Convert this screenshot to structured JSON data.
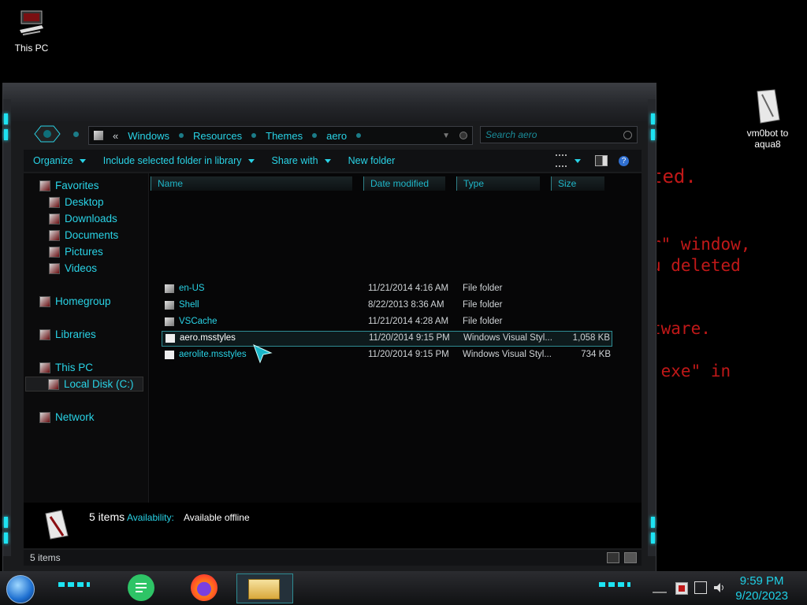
{
  "desktop": {
    "icons": [
      {
        "label": "This PC"
      },
      {
        "label": "vm0bot to aqua8"
      }
    ],
    "background_text": [
      "ted.",
      "r\" window,",
      "u deleted",
      "tware.",
      ".exe\" in"
    ]
  },
  "explorer": {
    "breadcrumb": [
      "«",
      "Windows",
      "Resources",
      "Themes",
      "aero"
    ],
    "search_placeholder": "Search aero",
    "toolbar": {
      "organize": "Organize",
      "include": "Include selected folder in library",
      "share": "Share with",
      "new_folder": "New folder"
    },
    "nav": {
      "favorites": "Favorites",
      "desktop": "Desktop",
      "downloads": "Downloads",
      "documents": "Documents",
      "pictures": "Pictures",
      "videos": "Videos",
      "homegroup": "Homegroup",
      "libraries": "Libraries",
      "this_pc": "This PC",
      "local_disk": "Local Disk (C:)",
      "network": "Network"
    },
    "columns": {
      "name": "Name",
      "date": "Date modified",
      "type": "Type",
      "size": "Size"
    },
    "files": [
      {
        "name": "en-US",
        "date": "11/21/2014 4:16 AM",
        "type": "File folder",
        "size": ""
      },
      {
        "name": "Shell",
        "date": "8/22/2013 8:36 AM",
        "type": "File folder",
        "size": ""
      },
      {
        "name": "VSCache",
        "date": "11/21/2014 4:28 AM",
        "type": "File folder",
        "size": ""
      },
      {
        "name": "aero.msstyles",
        "date": "11/20/2014 9:15 PM",
        "type": "Windows Visual Styl...",
        "size": "1,058 KB"
      },
      {
        "name": "aerolite.msstyles",
        "date": "11/20/2014 9:15 PM",
        "type": "Windows Visual Styl...",
        "size": "734 KB"
      }
    ],
    "details": {
      "count": "5 items",
      "availability_label": "Availability:",
      "availability_value": "Available offline"
    },
    "status": "5 items"
  },
  "taskbar": {
    "time": "9:59 PM",
    "date": "9/20/2023"
  },
  "colors": {
    "accent": "#29d3e6",
    "bg": "#000000",
    "alert_text": "#c01818"
  }
}
